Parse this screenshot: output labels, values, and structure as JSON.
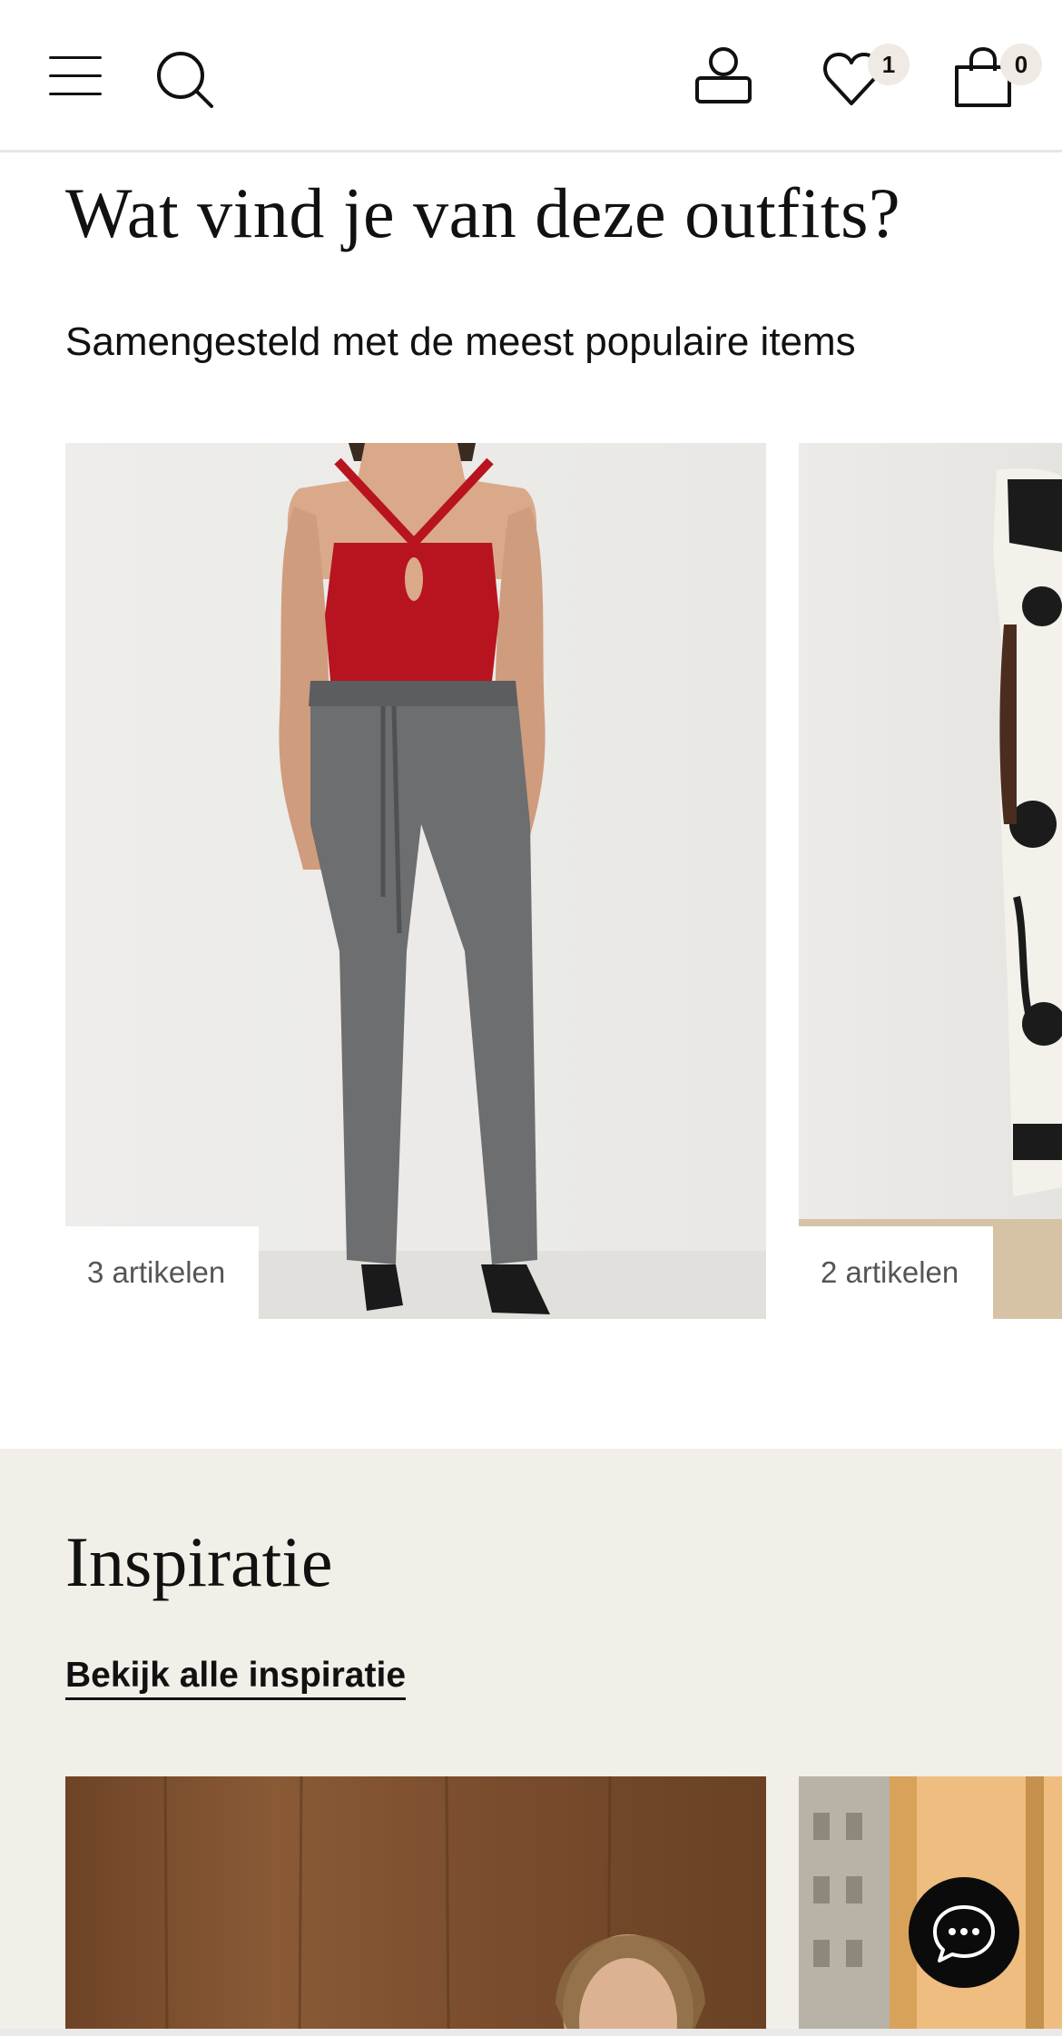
{
  "header": {
    "wishlist_count": "1",
    "cart_count": "0",
    "icons": [
      "menu-icon",
      "search-icon",
      "account-icon",
      "heart-icon",
      "shopping-bag-icon"
    ]
  },
  "outfits": {
    "title": "Wat vind je van deze outfits?",
    "subtitle": "Samengesteld met de meest populaire items",
    "cards": [
      {
        "label": "3 artikelen"
      },
      {
        "label": "2 artikelen"
      }
    ]
  },
  "inspiration": {
    "title": "Inspiratie",
    "link_label": "Bekijk alle inspiratie"
  },
  "chat": {
    "icon": "chat-bubble-icon"
  },
  "colors": {
    "accent": "#111111",
    "badge_bg": "#efeae3",
    "section_bg": "#f2eee8",
    "top_red": "#b8141f",
    "trousers_grey": "#6d6e70"
  }
}
